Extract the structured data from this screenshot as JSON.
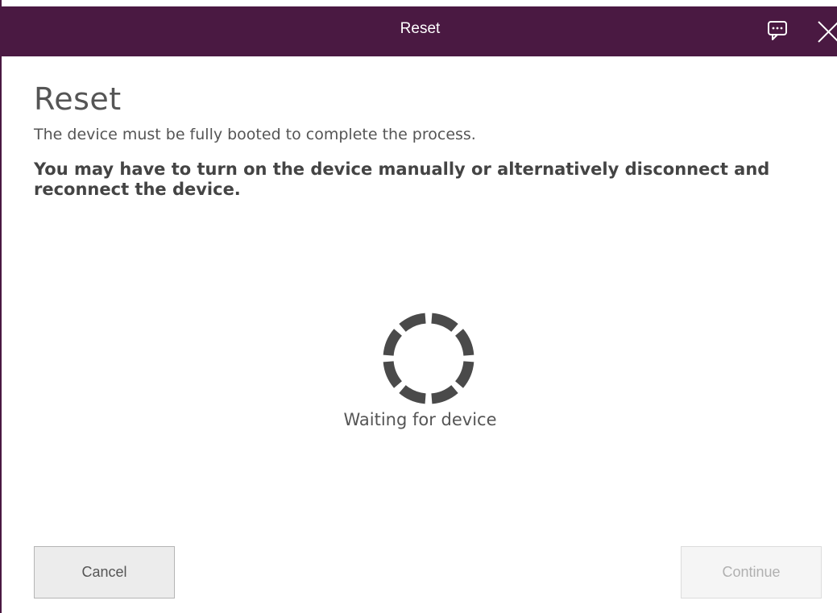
{
  "window": {
    "title": "Reset",
    "accent_color": "#4a1942",
    "feedback_icon": "feedback-chat-icon",
    "close_icon": "close-icon"
  },
  "main": {
    "heading": "Reset",
    "description": "The device must be fully booted to complete the process.",
    "instruction": "You may have to turn on the device manually or alternatively disconnect and reconnect the device."
  },
  "status": {
    "spinner_icon": "loading-spinner-icon",
    "text": "Waiting for device"
  },
  "footer": {
    "cancel_label": "Cancel",
    "continue_label": "Continue",
    "continue_enabled": false
  }
}
